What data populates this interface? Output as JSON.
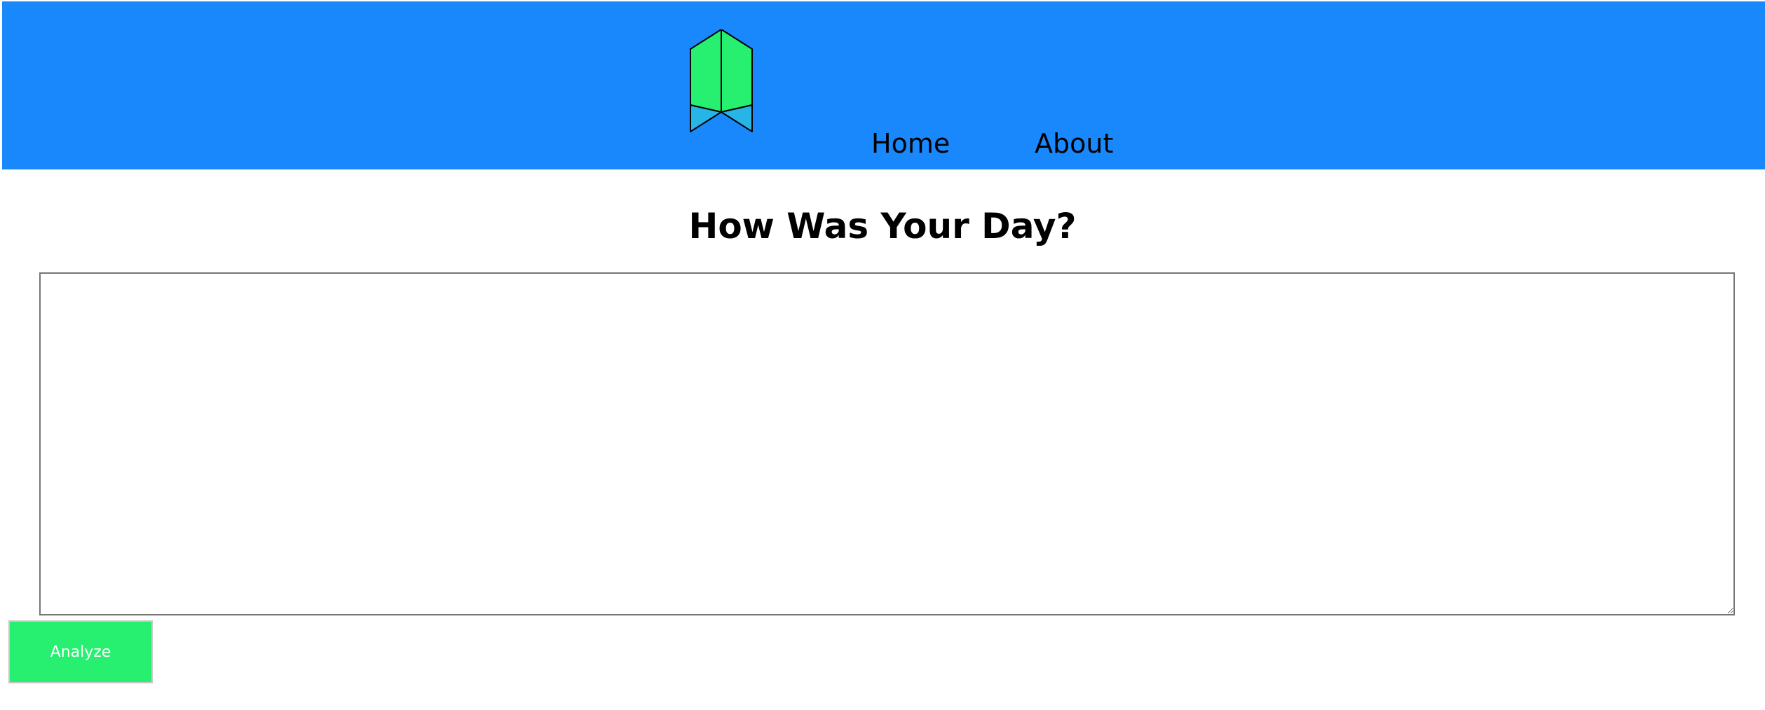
{
  "colors": {
    "header_background": "#1a88fd",
    "logo_upper": "#27ef70",
    "logo_lower": "#26b5e6",
    "button_background": "#27ef70",
    "button_text": "#ffffff"
  },
  "header": {
    "logo_icon": "ribbon-bookmark-icon",
    "nav": {
      "home_label": "Home",
      "about_label": "About"
    }
  },
  "main": {
    "title": "How Was Your Day?",
    "entry": {
      "value": "",
      "placeholder": ""
    },
    "analyze_label": "Analyze"
  }
}
